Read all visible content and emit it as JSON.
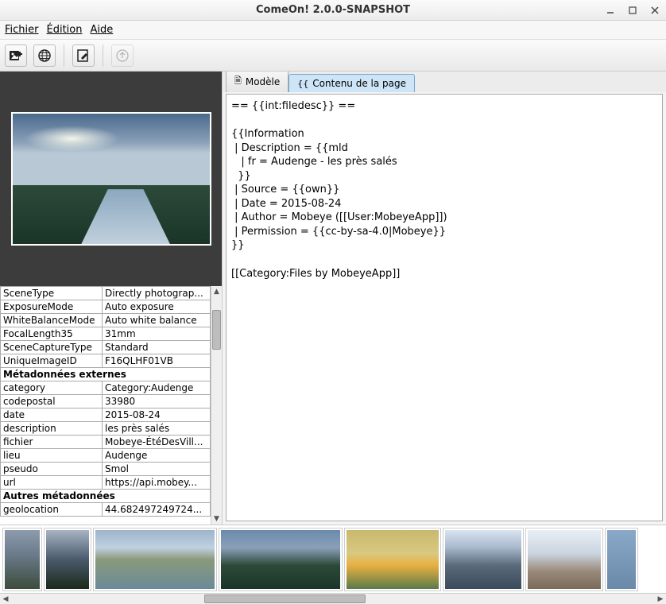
{
  "window": {
    "title": "ComeOn! 2.0.0-SNAPSHOT"
  },
  "menu": {
    "file": "Fichier",
    "edit": "Édition",
    "help": "Aide"
  },
  "tabs": {
    "model": "Modèle",
    "content": "Contenu de la page"
  },
  "editor_text": "== {{int:filedesc}} ==\n\n{{Information\n | Description = {{mld\n   | fr = Audenge - les près salés\n  }}\n | Source = {{own}}\n | Date = 2015-08-24\n | Author = Mobeye ([[User:MobeyeApp]])\n | Permission = {{cc-by-sa-4.0|Mobeye}}\n}}\n\n[[Category:Files by MobeyeApp]]",
  "metadata": {
    "exif_rows": [
      {
        "k": "SceneType",
        "v": "Directly photograp..."
      },
      {
        "k": "ExposureMode",
        "v": "Auto exposure"
      },
      {
        "k": "WhiteBalanceMode",
        "v": "Auto white balance"
      },
      {
        "k": "FocalLength35",
        "v": "31mm"
      },
      {
        "k": "SceneCaptureType",
        "v": "Standard"
      },
      {
        "k": "UniqueImageID",
        "v": "F16QLHF01VB"
      }
    ],
    "external_header": "Métadonnées externes",
    "external_rows": [
      {
        "k": "category",
        "v": "Category:Audenge"
      },
      {
        "k": "codepostal",
        "v": "33980"
      },
      {
        "k": "date",
        "v": "2015-08-24"
      },
      {
        "k": "description",
        "v": "les près salés"
      },
      {
        "k": "fichier",
        "v": "Mobeye-ÉtéDesVill..."
      },
      {
        "k": "lieu",
        "v": "Audenge"
      },
      {
        "k": "pseudo",
        "v": "Smol"
      },
      {
        "k": "url",
        "v": "https://api.mobey..."
      }
    ],
    "other_header": "Autres métadonnées",
    "other_rows": [
      {
        "k": "geolocation",
        "v": "44.682497249724..."
      }
    ]
  }
}
